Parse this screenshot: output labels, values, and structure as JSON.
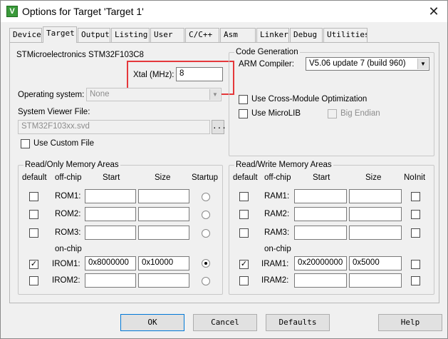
{
  "window": {
    "title": "Options for Target 'Target 1'",
    "app_icon": "keil-uvision-icon",
    "close_glyph": "✕"
  },
  "tabs": [
    {
      "label": "Device"
    },
    {
      "label": "Target"
    },
    {
      "label": "Output"
    },
    {
      "label": "Listing"
    },
    {
      "label": "User"
    },
    {
      "label": "C/C++"
    },
    {
      "label": "Asm"
    },
    {
      "label": "Linker"
    },
    {
      "label": "Debug"
    },
    {
      "label": "Utilities"
    }
  ],
  "active_tab": "Target",
  "device": {
    "name": "STMicroelectronics STM32F103C8"
  },
  "xtal": {
    "label": "Xtal (MHz):",
    "value": "8"
  },
  "os": {
    "label": "Operating system:",
    "value": "None"
  },
  "svd": {
    "label": "System Viewer File:",
    "value": "STM32F103xx.svd",
    "browse": "..."
  },
  "custom_file": {
    "label": "Use Custom File",
    "checked": false
  },
  "code_gen": {
    "title": "Code Generation",
    "compiler_label": "ARM Compiler:",
    "compiler_value": "V5.06 update 7 (build 960)",
    "cross_module": {
      "label": "Use Cross-Module Optimization",
      "checked": false
    },
    "microlib": {
      "label": "Use MicroLIB",
      "checked": false
    },
    "big_endian": {
      "label": "Big Endian",
      "checked": false
    }
  },
  "rom_areas": {
    "title": "Read/Only Memory Areas",
    "headers": {
      "default": "default",
      "offchip": "off-chip",
      "start": "Start",
      "size": "Size",
      "startup": "Startup"
    },
    "onchip_label": "on-chip",
    "rows": [
      {
        "name": "ROM1:",
        "start": "",
        "size": "",
        "default": false,
        "startup": false
      },
      {
        "name": "ROM2:",
        "start": "",
        "size": "",
        "default": false,
        "startup": false
      },
      {
        "name": "ROM3:",
        "start": "",
        "size": "",
        "default": false,
        "startup": false
      },
      {
        "name": "IROM1:",
        "start": "0x8000000",
        "size": "0x10000",
        "default": true,
        "startup": true
      },
      {
        "name": "IROM2:",
        "start": "",
        "size": "",
        "default": false,
        "startup": false
      }
    ]
  },
  "ram_areas": {
    "title": "Read/Write Memory Areas",
    "headers": {
      "default": "default",
      "offchip": "off-chip",
      "start": "Start",
      "size": "Size",
      "noinit": "NoInit"
    },
    "onchip_label": "on-chip",
    "rows": [
      {
        "name": "RAM1:",
        "start": "",
        "size": "",
        "default": false,
        "noinit": false
      },
      {
        "name": "RAM2:",
        "start": "",
        "size": "",
        "default": false,
        "noinit": false
      },
      {
        "name": "RAM3:",
        "start": "",
        "size": "",
        "default": false,
        "noinit": false
      },
      {
        "name": "IRAM1:",
        "start": "0x20000000",
        "size": "0x5000",
        "default": true,
        "noinit": false
      },
      {
        "name": "IRAM2:",
        "start": "",
        "size": "",
        "default": false,
        "noinit": false
      }
    ]
  },
  "buttons": {
    "ok": "OK",
    "cancel": "Cancel",
    "defaults": "Defaults",
    "help": "Help"
  },
  "colors": {
    "highlight": "#e5383b",
    "focus": "#0078d7"
  }
}
